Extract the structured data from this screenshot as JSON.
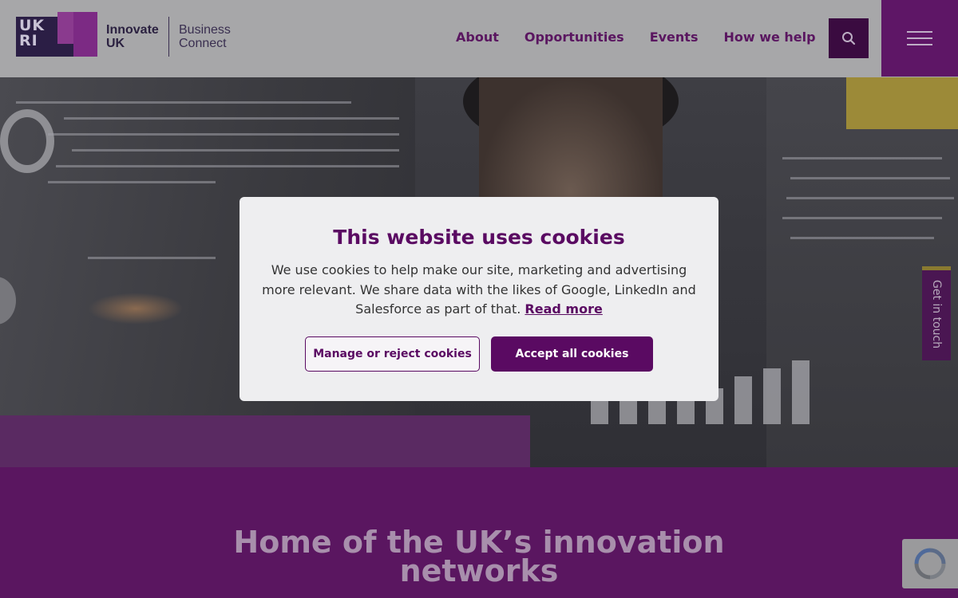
{
  "header": {
    "logo": {
      "ukri_text": "UK RI",
      "innovate_line1": "Innovate",
      "innovate_line2": "UK",
      "business_line1": "Business",
      "business_line2": "Connect"
    },
    "nav": [
      {
        "label": "About"
      },
      {
        "label": "Opportunities"
      },
      {
        "label": "Events"
      },
      {
        "label": "How we help"
      }
    ],
    "search_icon": "search-icon",
    "menu_icon": "hamburger-menu-icon"
  },
  "side_tab": {
    "label": "Get in touch"
  },
  "main": {
    "title": "Home of the UK’s innovation networks"
  },
  "cookie_dialog": {
    "title": "This website uses cookies",
    "body": "We use cookies to help make our site, marketing and advertising more relevant. We share data with the likes of Google, LinkedIn and Salesforce as part of that.",
    "read_more": "Read more",
    "manage_label": "Manage or reject cookies",
    "accept_label": "Accept all cookies"
  },
  "colors": {
    "brand_purple": "#5a0a62",
    "header_bg": "#a7a7a9",
    "section_bg": "#5a1660"
  }
}
